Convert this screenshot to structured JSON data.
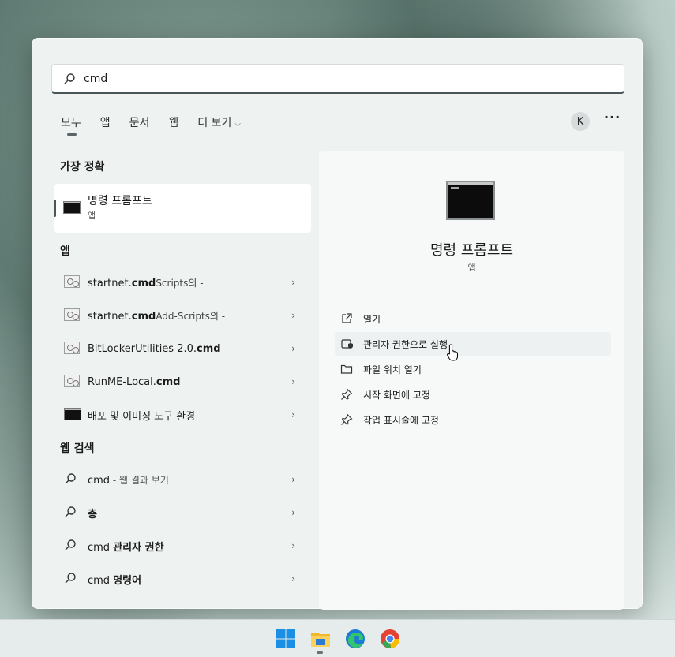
{
  "search": {
    "value": "cmd"
  },
  "tabs": [
    {
      "label": "모두"
    },
    {
      "label": "앱"
    },
    {
      "label": "문서"
    },
    {
      "label": "웹"
    },
    {
      "label": "더 보기"
    }
  ],
  "user": {
    "initial": "K",
    "more": "···"
  },
  "sections": {
    "best_match": "가장 정확",
    "apps": "앱",
    "web": "웹 검색"
  },
  "best_match": {
    "title": "명령 프롬프트",
    "subtitle": "앱"
  },
  "apps": [
    {
      "name": "startnet.",
      "bold": "cmd",
      "suffix": "Scripts의 -"
    },
    {
      "name": "startnet.",
      "bold": "cmd",
      "suffix": "Add-Scripts의 -"
    },
    {
      "name": "BitLockerUtilities 2.0.",
      "bold": "cmd",
      "suffix": ""
    },
    {
      "name": "RunME-Local.",
      "bold": "cmd",
      "suffix": ""
    },
    {
      "name": "배포 및 이미징 도구 환경",
      "bold": "",
      "suffix": ""
    }
  ],
  "web": [
    {
      "prefix": "cmd",
      "bold": "",
      "suffix": " - 웹 결과 보기"
    },
    {
      "prefix": "",
      "bold": "층",
      "suffix": ""
    },
    {
      "prefix": "cmd ",
      "bold": "관리자 권한",
      "suffix": ""
    },
    {
      "prefix": "cmd ",
      "bold": "명령어",
      "suffix": ""
    }
  ],
  "detail": {
    "title": "명령 프롬프트",
    "subtitle": "앱",
    "actions": [
      {
        "label": "열기",
        "icon": "open-external-icon"
      },
      {
        "label": "관리자 권한으로 실행",
        "icon": "shield-icon"
      },
      {
        "label": "파일 위치 열기",
        "icon": "folder-icon"
      },
      {
        "label": "시작 화면에 고정",
        "icon": "pin-icon"
      },
      {
        "label": "작업 표시줄에 고정",
        "icon": "pin-icon"
      }
    ]
  },
  "taskbar": [
    {
      "name": "windows-start-icon"
    },
    {
      "name": "file-explorer-icon"
    },
    {
      "name": "edge-icon"
    },
    {
      "name": "chrome-icon"
    }
  ],
  "chevron": "›"
}
